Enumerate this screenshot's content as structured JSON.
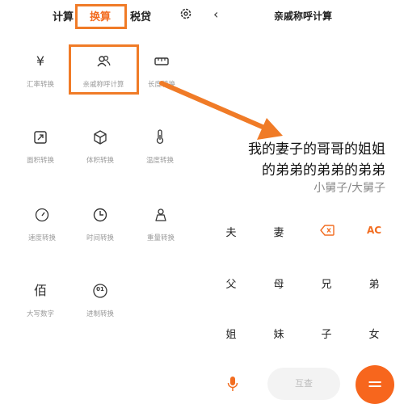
{
  "left": {
    "tabs": [
      "计算",
      "换算",
      "税贷"
    ],
    "items": [
      {
        "glyph": "¥",
        "label": "汇率转换"
      },
      {
        "label": "亲戚称呼计算"
      },
      {
        "label": "长度转换"
      },
      {
        "label": "面积转换"
      },
      {
        "label": "体积转换"
      },
      {
        "label": "温度转换"
      },
      {
        "label": "速度转换"
      },
      {
        "label": "时间转换"
      },
      {
        "label": "重量转换"
      },
      {
        "glyph": "佰",
        "label": "大写数字"
      },
      {
        "glyph": "01",
        "label": "进制转换"
      }
    ]
  },
  "right": {
    "back": "‹",
    "title": "亲戚称呼计算",
    "expression_line1": "我的妻子的哥哥的姐姐",
    "expression_line2": "的弟弟的弟弟的弟弟",
    "result": "小舅子/大舅子",
    "keys": {
      "row1": [
        "夫",
        "妻",
        "",
        "AC"
      ],
      "row2": [
        "父",
        "母",
        "兄",
        "弟"
      ],
      "row3": [
        "姐",
        "妹",
        "子",
        "女"
      ]
    },
    "swap_label": "互查",
    "equals_label": "="
  },
  "colors": {
    "accent": "#f26d21",
    "highlight": "#f07b27"
  }
}
